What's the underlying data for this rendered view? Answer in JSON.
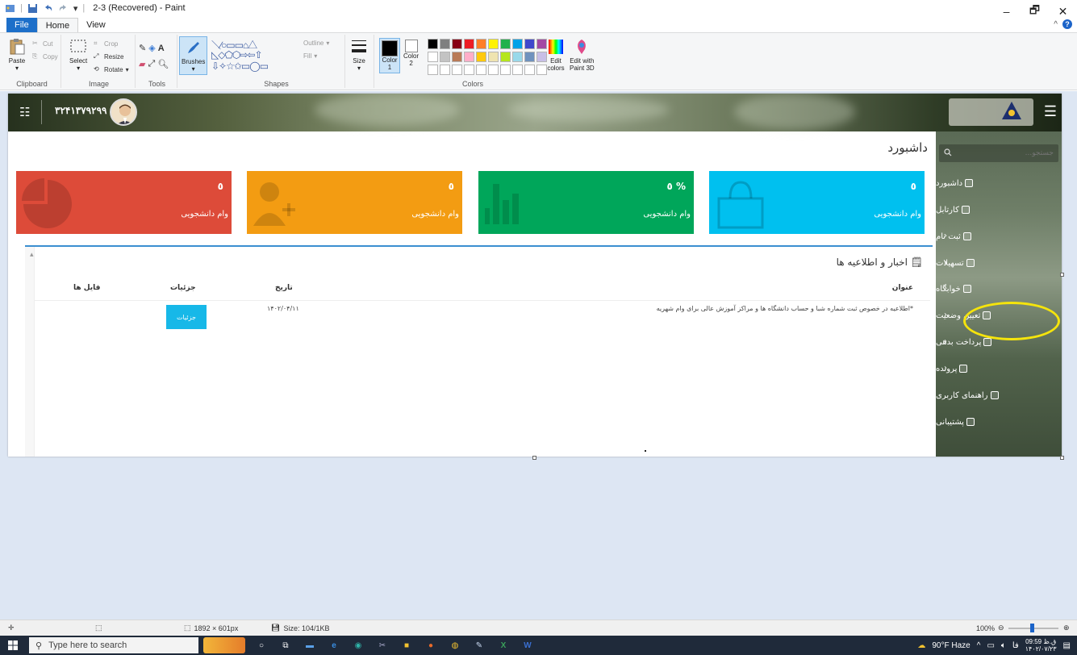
{
  "window": {
    "title": "2-3 (Recovered) - Paint",
    "minimize": "–",
    "restore": "🗗",
    "close": "✕"
  },
  "ribbon_tabs": {
    "file": "File",
    "home": "Home",
    "view": "View"
  },
  "ribbon": {
    "clipboard": {
      "paste": "Paste",
      "cut": "Cut",
      "copy": "Copy",
      "label": "Clipboard"
    },
    "image": {
      "select": "Select",
      "crop": "Crop",
      "resize": "Resize",
      "rotate": "Rotate",
      "label": "Image"
    },
    "tools": {
      "label": "Tools"
    },
    "brushes": "Brushes",
    "shapes": {
      "outline": "Outline",
      "fill": "Fill",
      "label": "Shapes"
    },
    "size": "Size",
    "colors": {
      "color1": "Color",
      "color1_num": "1",
      "color2": "Color",
      "color2_num": "2",
      "edit": "Edit",
      "edit2": "colors",
      "edit3d": "Edit with",
      "edit3d2": "Paint 3D",
      "label": "Colors"
    },
    "palette_row1": [
      "#000000",
      "#7f7f7f",
      "#880015",
      "#ed1c24",
      "#ff7f27",
      "#fff200",
      "#22b14c",
      "#00a2e8",
      "#3f48cc",
      "#a349a4"
    ],
    "palette_row2": [
      "#ffffff",
      "#c3c3c3",
      "#b97a57",
      "#ffaec9",
      "#ffc90e",
      "#efe4b0",
      "#b5e61d",
      "#99d9ea",
      "#7092be",
      "#c8bfe7"
    ]
  },
  "site": {
    "phone": "۳۲۴۱۳۷۹۲۹۹",
    "page_title": "داشبورد",
    "search_placeholder": "جستجو...",
    "tiles": [
      {
        "value": "٥",
        "label": "وام دانشجویی",
        "color": "#dd4b39"
      },
      {
        "value": "٥",
        "label": "وام دانشجویی",
        "color": "#f39c12"
      },
      {
        "value": "٥ %",
        "label": "وام دانشجویی",
        "color": "#00a65a"
      },
      {
        "value": "٥",
        "label": "وام دانشجویی",
        "color": "#00c0ef"
      }
    ],
    "sidebar": [
      "داشبورد",
      "کارتابل",
      "ثبت نام",
      "تسهیلات",
      "خوابگاه",
      "تعیین وضعیت",
      "پرداخت بدهی",
      "پرونده",
      "راهنمای کاربری",
      "پشتیبانی"
    ],
    "news": {
      "title": "اخبار و اطلاعیه ها",
      "col_title": "عنوان",
      "col_date": "تاریخ",
      "col_details": "جزئیات",
      "col_files": "فایل ها",
      "row_title": "*اطلاعیه در خصوص ثبت شماره شبا و حساب دانشگاه ها و مراکز آموزش عالی برای وام شهریه",
      "row_date": "۱۴۰۲/۰۴/۱۱",
      "row_button": "جزئیات"
    }
  },
  "statusbar": {
    "dimensions": "1892 × 601px",
    "size": "Size: 104/1KB",
    "zoom": "100%"
  },
  "taskbar": {
    "search_placeholder": "Type here to search",
    "weather": "90°F Haze",
    "lang": "فا",
    "time": "09:59 ق.ظ",
    "date": "۱۴۰۲/۰۷/۲۳"
  }
}
